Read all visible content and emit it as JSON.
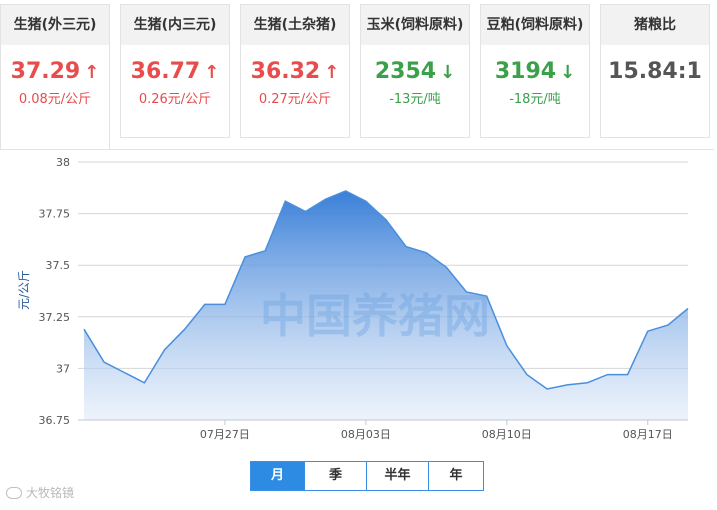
{
  "cards": [
    {
      "title": "生猪(外三元)",
      "price": "37.29",
      "arrow": "↑",
      "trend": "up",
      "change": "0.08元/公斤"
    },
    {
      "title": "生猪(内三元)",
      "price": "36.77",
      "arrow": "↑",
      "trend": "up",
      "change": "0.26元/公斤"
    },
    {
      "title": "生猪(土杂猪)",
      "price": "36.32",
      "arrow": "↑",
      "trend": "up",
      "change": "0.27元/公斤"
    },
    {
      "title": "玉米(饲料原料)",
      "price": "2354",
      "arrow": "↓",
      "trend": "down",
      "change": "-13元/吨"
    },
    {
      "title": "豆粕(饲料原料)",
      "price": "3194",
      "arrow": "↓",
      "trend": "down",
      "change": "-18元/吨"
    },
    {
      "title": "猪粮比",
      "price": "15.84:1",
      "arrow": "",
      "trend": "neutral",
      "change": ""
    }
  ],
  "watermark": "中国养猪网",
  "brand_watermark": "大牧铭镜",
  "range_tabs": [
    {
      "label": "月",
      "selected": true
    },
    {
      "label": "季",
      "selected": false
    },
    {
      "label": "半年",
      "selected": false
    },
    {
      "label": "年",
      "selected": false
    }
  ],
  "colors": {
    "up": "#e84c4c",
    "down": "#3aa04a",
    "line": "#4a8fdc",
    "tab_active": "#2d8be3"
  },
  "chart_data": {
    "type": "area",
    "ylabel": "元/公斤",
    "ylim": [
      36.75,
      38
    ],
    "yticks": [
      36.75,
      37,
      37.25,
      37.5,
      37.75,
      38
    ],
    "ytick_labels": [
      "36.75",
      "37",
      "37.25",
      "37.5",
      "37.75",
      "38"
    ],
    "xticks": [
      {
        "label": "07月27日",
        "day": 7
      },
      {
        "label": "08月03日",
        "day": 14
      },
      {
        "label": "08月10日",
        "day": 21
      },
      {
        "label": "08月17日",
        "day": 28
      }
    ],
    "grid": true,
    "series": [
      {
        "values": [
          37.19,
          37.03,
          36.98,
          36.93,
          37.09,
          37.19,
          37.31,
          37.31,
          37.54,
          37.57,
          37.81,
          37.76,
          37.82,
          37.86,
          37.81,
          37.72,
          37.59,
          37.56,
          37.49,
          37.37,
          37.35,
          37.11,
          36.97,
          36.9,
          36.92,
          36.93,
          36.97,
          36.97,
          37.18,
          37.21,
          37.29
        ]
      }
    ]
  }
}
